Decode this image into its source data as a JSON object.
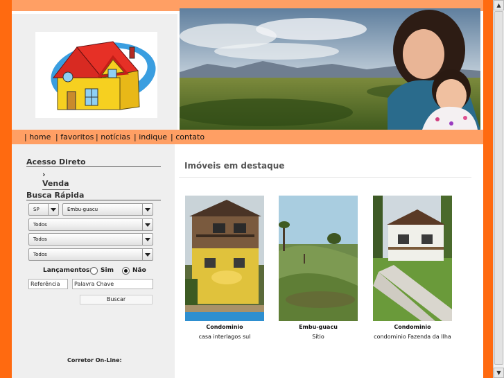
{
  "nav": {
    "items": [
      "| home",
      "| favoritos",
      "| notícias",
      "| indique",
      "| contato"
    ]
  },
  "sidebar": {
    "acesso_title": "Acesso Direto",
    "venda_link": "› Venda",
    "busca_title": "Busca Rápida",
    "state_select": "SP",
    "city_select": "Embu-guacu",
    "filter_1": "Todos",
    "filter_2": "Todos",
    "filter_3": "Todos",
    "lancamentos_label": "Lançamentos:",
    "radio_sim": "Sim",
    "radio_nao": "Não",
    "radio_selected": "Não",
    "referencia_value": "Referência",
    "palavra_value": "Palavra Chave",
    "buscar_button": "Buscar",
    "corretor_label": "Corretor On-Line:"
  },
  "main": {
    "section_title": "Imóveis em destaque",
    "listings": [
      {
        "city": "Condominio",
        "description": "casa interlagos sul"
      },
      {
        "city": "Embu-guacu",
        "description": "Sítio"
      },
      {
        "city": "Condominio",
        "description": "condominio Fazenda da Ilha"
      }
    ]
  },
  "scrollbar": {
    "up_icon": "▲",
    "down_icon": "▼"
  },
  "colors": {
    "frame_orange": "#ff6a10",
    "bar_orange": "#ff9f64",
    "sidebar_gray": "#efefef"
  }
}
